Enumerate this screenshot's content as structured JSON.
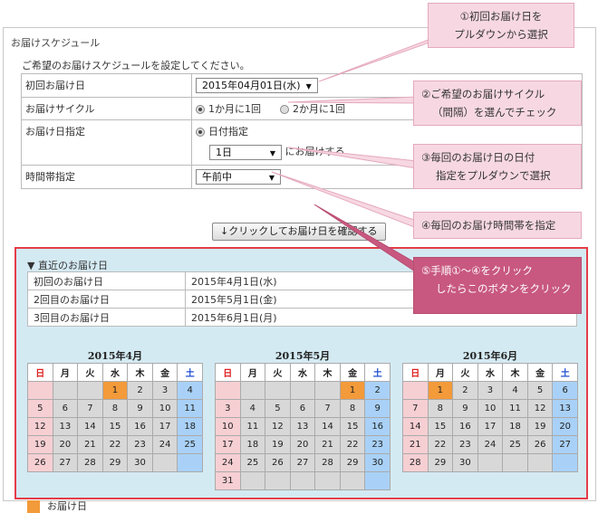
{
  "section_title": "お届けスケジュール",
  "intro": "ご希望のお届けスケジュールを設定してください。",
  "form": {
    "first_date_label": "初回お届け日",
    "first_date_value": "2015年04月01日(水)",
    "cycle_label": "お届けサイクル",
    "cycle_options": [
      "1か月に1回",
      "2か月に1回"
    ],
    "dayspec_label": "お届け日指定",
    "dayspec_option": "日付指定",
    "day_value": "1日",
    "day_suffix": "にお届けする",
    "time_label": "時間帯指定",
    "time_value": "午前中"
  },
  "confirm_button": "↓クリックしてお届け日を確認する",
  "recent": {
    "title": "▼ 直近のお届け日",
    "rows": [
      {
        "label": "初回のお届け日",
        "value": "2015年4月1日(水)"
      },
      {
        "label": "2回目のお届け日",
        "value": "2015年5月1日(金)"
      },
      {
        "label": "3回目のお届け日",
        "value": "2015年6月1日(月)"
      }
    ]
  },
  "weekdays": [
    "日",
    "月",
    "火",
    "水",
    "木",
    "金",
    "土"
  ],
  "calendars": [
    {
      "title": "2015年4月",
      "start": 3,
      "days": 30,
      "deliver": 1
    },
    {
      "title": "2015年5月",
      "start": 5,
      "days": 31,
      "deliver": 1
    },
    {
      "title": "2015年6月",
      "start": 1,
      "days": 30,
      "deliver": 1
    }
  ],
  "legend": "お届け日",
  "callouts": [
    {
      "line1": "①初回お届け日を",
      "line2": "プルダウンから選択"
    },
    {
      "line1": "②ご希望のお届けサイクル",
      "line2": "（間隔）を選んでチェック"
    },
    {
      "line1": "③毎回のお届け日の日付",
      "line2": "指定をプルダウンで選択"
    },
    {
      "line1": "④毎回のお届け時間帯を指定",
      "line2": ""
    },
    {
      "line1": "⑤手順①～④をクリック",
      "line2": "したらこのボタンをクリック"
    }
  ],
  "colors": {
    "delivery": "#f39a3a",
    "sunday": "#f6cfd3",
    "saturday": "#a9d1f7",
    "border_red": "#e43d48"
  }
}
